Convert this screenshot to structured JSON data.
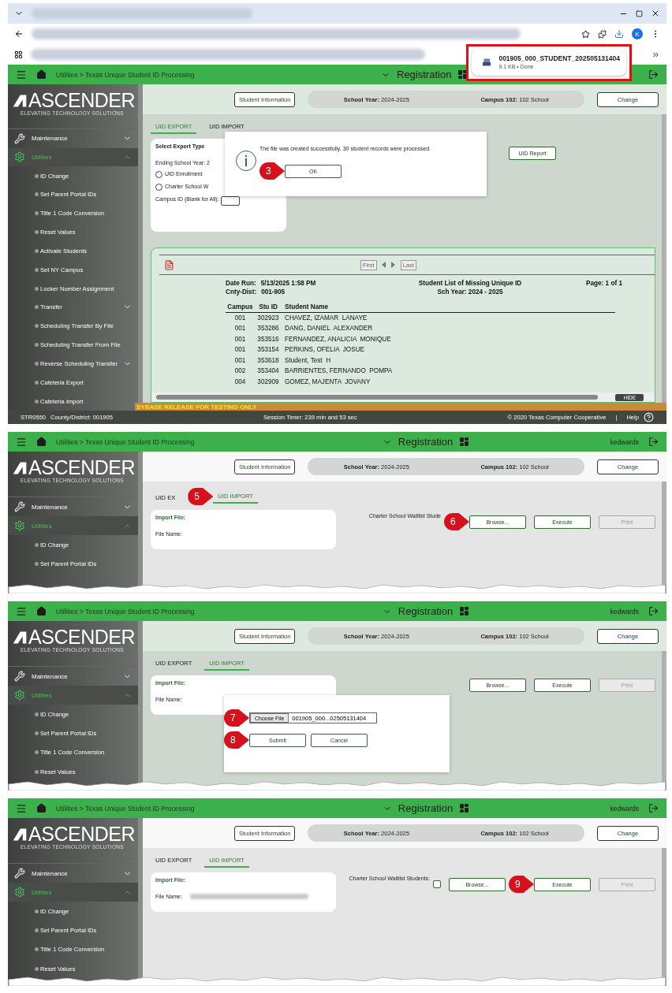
{
  "browser": {
    "avatar": "K",
    "download": {
      "file_name": "001905_000_STUDENT_202505131404",
      "details": "9.1 KB • Done"
    }
  },
  "panels": [
    {
      "kind": "export",
      "header": {
        "breadcrumb": "Utilities > Texas Unique Student ID Processing",
        "module": "Registration"
      },
      "logo": {
        "name": "ASCENDER",
        "tagline": "ELEVATING TECHNOLOGY SOLUTIONS"
      },
      "sidebar": [
        {
          "label": "Maintenance",
          "expanded": false,
          "selected": false
        },
        {
          "label": "Utilities",
          "expanded": true,
          "selected": true,
          "children": [
            {
              "label": "ID Change"
            },
            {
              "label": "Set Parent Portal IDs"
            },
            {
              "label": "Title 1 Code Conversion"
            },
            {
              "label": "Reset Values"
            },
            {
              "label": "Activate Students"
            },
            {
              "label": "Set NY Campus"
            },
            {
              "label": "Locker Number Assignment"
            },
            {
              "label": "Transfer",
              "expanded": false
            },
            {
              "label": "Scheduling Transfer By File"
            },
            {
              "label": "Scheduling Transfer From File"
            },
            {
              "label": "Reverse Scheduling Transfer",
              "expanded": false
            },
            {
              "label": "Cafeteria Export"
            },
            {
              "label": "Cafeteria Import"
            }
          ]
        }
      ],
      "context": {
        "button": "Student Information",
        "year_label": "School Year:",
        "year": "2024-2025",
        "campus_label": "Campus 102:",
        "campus": "102 School",
        "change": "Change"
      },
      "tabs": [
        {
          "label": "UID EXPORT",
          "selected": true
        },
        {
          "label": "UID IMPORT",
          "selected": false
        }
      ],
      "export": {
        "title": "Select Export Type",
        "report_button": "UID Report",
        "year_label": "Ending School Year: 2",
        "radios": [
          {
            "label": "UID Enrollment",
            "selected": false
          },
          {
            "label": "Charter School W",
            "selected": false
          }
        ],
        "campus_label": "Campus ID (Blank for All):"
      },
      "report": {
        "first": "First",
        "last": "Last",
        "date_label": "Date Run:",
        "date": "5/13/2025 1:58 PM",
        "dist_label": "Cnty-Dist:",
        "dist": "001-905",
        "title": "Student List of Missing Unique ID",
        "sch_year": "Sch Year: 2024 - 2025",
        "page": "Page: 1 of 1",
        "columns": [
          "Campus",
          "Stu ID",
          "Student Name"
        ],
        "rows": [
          [
            "001",
            "302923",
            "CHAVEZ, IZAMAR  LANAYE"
          ],
          [
            "001",
            "353286",
            "DANG, DANIEL  ALEXANDER"
          ],
          [
            "001",
            "353516",
            "FERNANDEZ, ANALICIA  MONIQUE"
          ],
          [
            "001",
            "353154",
            "PERKINS, OFELIA  JOSUE"
          ],
          [
            "001",
            "353618",
            "Student, Test  H"
          ],
          [
            "002",
            "353404",
            "BARRIENTES, FERNANDO  POMPA"
          ],
          [
            "004",
            "302909",
            "GOMEZ, MAJENTA  JOVANY"
          ]
        ],
        "hide": "HIDE"
      },
      "banner": "SYBASE RELEASE FOR TESTING ONLY",
      "status": {
        "code": "STR0550",
        "district": "County/District: 001905",
        "timer": "Session Timer: 239 min and 53 sec",
        "copyright": "© 2020 Texas Computer Cooperative",
        "separator": "|",
        "help": "Help"
      },
      "dialog": {
        "kind": "message",
        "message": "The file was created successfully. 30 student records were processed.",
        "ok": "OK",
        "step": "3"
      }
    },
    {
      "kind": "import",
      "header": {
        "breadcrumb": "Utilities > Texas Unique Student ID Processing",
        "module": "Registration",
        "user": "kedwards"
      },
      "logo": {
        "name": "ASCENDER",
        "tagline": "ELEVATING TECHNOLOGY SOLUTIONS"
      },
      "sidebar": [
        {
          "label": "Maintenance",
          "expanded": false,
          "selected": false
        },
        {
          "label": "Utilities",
          "expanded": true,
          "selected": true,
          "children": [
            {
              "label": "ID Change"
            },
            {
              "label": "Set Parent Portal IDs"
            }
          ]
        }
      ],
      "context": {
        "button": "Student Information",
        "year_label": "School Year:",
        "year": "2024-2025",
        "campus_label": "Campus 102:",
        "campus": "102 School",
        "change": "Change"
      },
      "tabs": [
        {
          "label": "UID EX",
          "selected": false
        },
        {
          "label": "UID IMPORT",
          "selected": true,
          "step": "5"
        }
      ],
      "import": {
        "file_label": "Import File:",
        "name_label": "File Name:",
        "charter_label": "Charter School Waitlist Stude",
        "buttons": [
          {
            "label": "Browse...",
            "disabled": false,
            "step": "6"
          },
          {
            "label": "Execute",
            "disabled": false
          },
          {
            "label": "Print",
            "disabled": true
          }
        ]
      }
    },
    {
      "kind": "import",
      "header": {
        "breadcrumb": "Utilities > Texas Unique Student ID Processing",
        "module": "Registration",
        "user": "kedwards"
      },
      "logo": {
        "name": "ASCENDER",
        "tagline": "ELEVATING TECHNOLOGY SOLUTIONS"
      },
      "sidebar": [
        {
          "label": "Maintenance",
          "expanded": false,
          "selected": false
        },
        {
          "label": "Utilities",
          "expanded": true,
          "selected": true,
          "children": [
            {
              "label": "ID Change"
            },
            {
              "label": "Set Parent Portal IDs"
            },
            {
              "label": "Title 1 Code Conversion"
            },
            {
              "label": "Reset Values"
            }
          ]
        }
      ],
      "context": {
        "button": "Student Information",
        "year_label": "School Year:",
        "year": "2024-2025",
        "campus_label": "Campus 102:",
        "campus": "102 School",
        "change": "Change"
      },
      "tabs": [
        {
          "label": "UID EXPORT",
          "selected": false
        },
        {
          "label": "UID IMPORT",
          "selected": true
        }
      ],
      "import": {
        "file_label": "Import File:",
        "name_label": "File Name:",
        "buttons": [
          {
            "label": "Browse...",
            "disabled": false
          },
          {
            "label": "Execute",
            "disabled": false
          },
          {
            "label": "Print",
            "disabled": true
          }
        ]
      },
      "dialog": {
        "kind": "upload",
        "choose": "Choose File",
        "file": "001905_000...02505131404",
        "file_step": "7",
        "submit": "Submit",
        "submit_step": "8",
        "cancel": "Cancel"
      }
    },
    {
      "kind": "import",
      "header": {
        "breadcrumb": "Utilities > Texas Unique Student ID Processing",
        "module": "Registration",
        "user": "kedwards"
      },
      "logo": {
        "name": "ASCENDER",
        "tagline": "ELEVATING TECHNOLOGY SOLUTIONS"
      },
      "sidebar": [
        {
          "label": "Maintenance",
          "expanded": false,
          "selected": false
        },
        {
          "label": "Utilities",
          "expanded": true,
          "selected": true,
          "children": [
            {
              "label": "ID Change"
            },
            {
              "label": "Set Parent Portal IDs"
            },
            {
              "label": "Title 1 Code Conversion"
            },
            {
              "label": "Reset Values"
            }
          ]
        }
      ],
      "context": {
        "button": "Student Information",
        "year_label": "School Year:",
        "year": "2024-2025",
        "campus_label": "Campus 102:",
        "campus": "102 School",
        "change": "Change"
      },
      "tabs": [
        {
          "label": "UID EXPORT",
          "selected": false
        },
        {
          "label": "UID IMPORT",
          "selected": true
        }
      ],
      "import": {
        "file_label": "Import File:",
        "name_label": "File Name:",
        "file_name_blurred": true,
        "charter_label": "Charter School Waitlist Students:",
        "charter_checked": false,
        "buttons": [
          {
            "label": "Browse...",
            "disabled": false
          },
          {
            "label": "Execute",
            "disabled": false,
            "step": "9"
          },
          {
            "label": "Print",
            "disabled": true
          }
        ]
      }
    }
  ]
}
